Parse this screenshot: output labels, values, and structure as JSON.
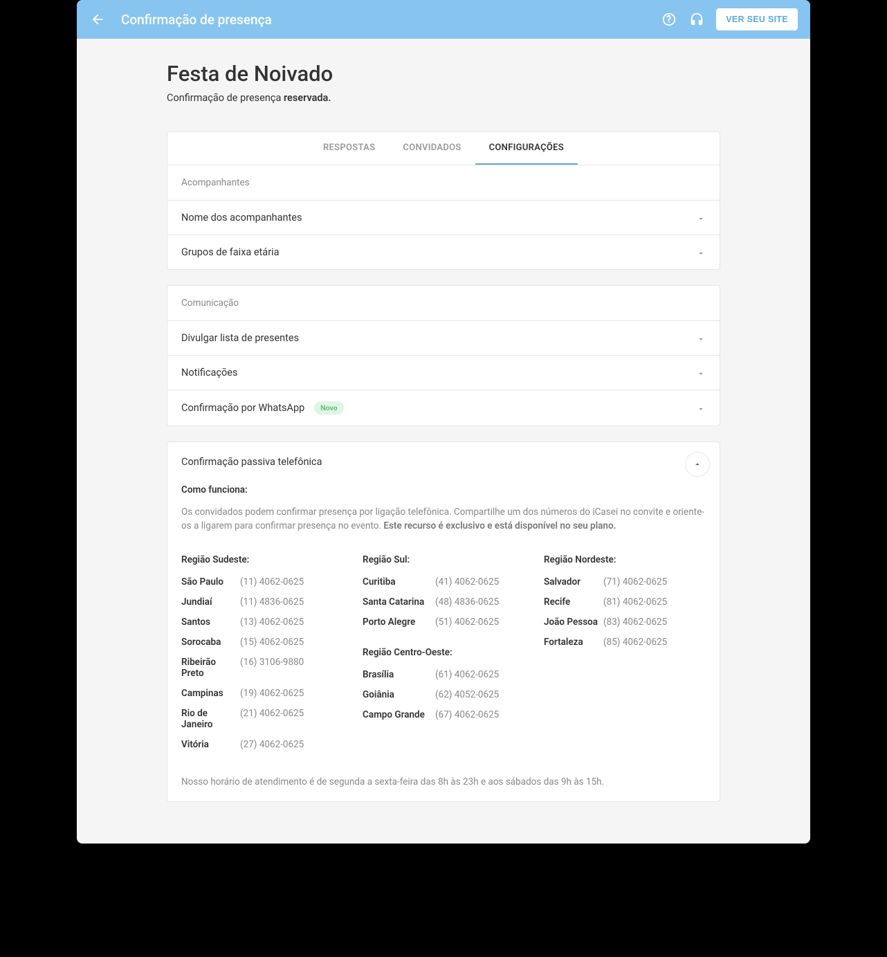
{
  "header": {
    "title": "Confirmação de presença",
    "viewSite": "VER SEU SITE"
  },
  "page": {
    "title": "Festa de Noivado",
    "subtitlePrefix": "Confirmação de presença ",
    "subtitleBold": "reservada."
  },
  "tabs": {
    "respostas": "RESPOSTAS",
    "convidados": "CONVIDADOS",
    "configuracoes": "CONFIGURAÇÕES"
  },
  "sections": {
    "acompanhantes": {
      "title": "Acompanhantes",
      "rows": {
        "nomes": "Nome dos acompanhantes",
        "grupos": "Grupos de faixa etária"
      }
    },
    "comunicacao": {
      "title": "Comunicação",
      "rows": {
        "divulgar": "Divulgar lista de presentes",
        "notificacoes": "Notificações",
        "whatsapp": "Confirmação por WhatsApp",
        "whatsappBadge": "Novo"
      }
    }
  },
  "expanded": {
    "title": "Confirmação passiva telefônica",
    "howWorks": "Como funciona:",
    "descPrefix": "Os convidados podem confirmar presença por ligação telefônica. Compartilhe um dos números do iCasei no convite e oriente-os a ligarem para confirmar presença no evento. ",
    "descBold": "Este recurso é exclusivo e está disponível no seu plano.",
    "hours": "Nosso horário de atendimento é de segunda a sexta-feira das 8h às 23h e aos sábados das 9h às 15h.",
    "regions": {
      "sudeste": {
        "name": "Região Sudeste:",
        "items": [
          {
            "city": "São Paulo",
            "phone": "(11) 4062-0625"
          },
          {
            "city": "Jundiaí",
            "phone": "(11) 4836-0625"
          },
          {
            "city": "Santos",
            "phone": "(13) 4062-0625"
          },
          {
            "city": "Sorocaba",
            "phone": "(15) 4062-0625"
          },
          {
            "city": "Ribeirão Preto",
            "phone": "(16) 3106-9880"
          },
          {
            "city": "Campinas",
            "phone": "(19) 4062-0625"
          },
          {
            "city": "Rio de Janeiro",
            "phone": "(21) 4062-0625"
          },
          {
            "city": "Vitória",
            "phone": "(27) 4062-0625"
          }
        ]
      },
      "sul": {
        "name": "Região Sul:",
        "items": [
          {
            "city": "Curitiba",
            "phone": "(41) 4062-0625"
          },
          {
            "city": "Santa Catarina",
            "phone": "(48) 4836-0625"
          },
          {
            "city": "Porto Alegre",
            "phone": "(51) 4062-0625"
          }
        ]
      },
      "centroOeste": {
        "name": "Região Centro-Oeste:",
        "items": [
          {
            "city": "Brasília",
            "phone": "(61) 4062-0625"
          },
          {
            "city": "Goiânia",
            "phone": "(62) 4052-0625"
          },
          {
            "city": "Campo Grande",
            "phone": "(67) 4062-0625"
          }
        ]
      },
      "nordeste": {
        "name": "Região Nordeste:",
        "items": [
          {
            "city": "Salvador",
            "phone": "(71) 4062-0625"
          },
          {
            "city": "Recife",
            "phone": "(81) 4062-0625"
          },
          {
            "city": "João Pessoa",
            "phone": "(83) 4062-0625"
          },
          {
            "city": "Fortaleza",
            "phone": "(85) 4062-0625"
          }
        ]
      }
    }
  }
}
